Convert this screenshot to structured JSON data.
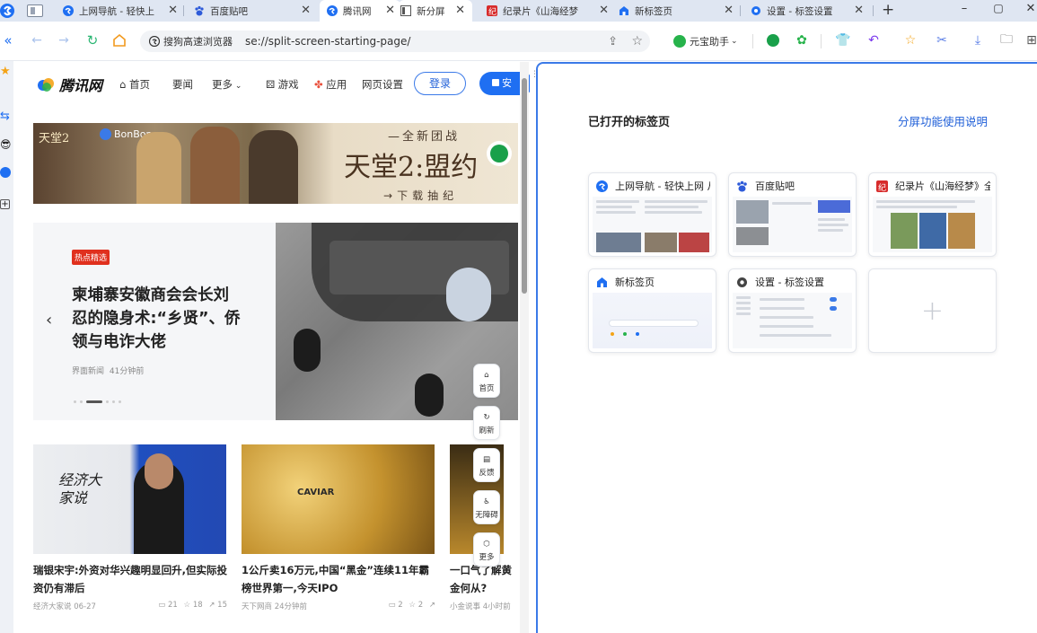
{
  "tabs": [
    {
      "label": "上网导航 - 轻快上",
      "icon": "sogou-logo-icon",
      "active": false
    },
    {
      "label": "百度贴吧",
      "icon": "baidu-paw-icon",
      "active": false
    },
    {
      "label": "腾讯网",
      "icon": "sogou-logo-icon",
      "active": true
    },
    {
      "label": "新分屏",
      "icon": "split-screen-icon",
      "active": false
    },
    {
      "label": "纪录片《山海经梦",
      "icon": "documentary-red-icon",
      "active": false
    },
    {
      "label": "新标签页",
      "icon": "home-icon",
      "active": false
    },
    {
      "label": "设置 - 标签设置",
      "icon": "gear-icon",
      "active": false
    }
  ],
  "toolbar": {
    "site_label": "搜狗高速浏览器",
    "url": "se://split-screen-starting-page/",
    "assistant_label": "元宝助手"
  },
  "qq_nav": {
    "logo_text": "腾讯网",
    "items": [
      "首页",
      "要闻",
      "更多",
      "游戏",
      "应用",
      "网页设置"
    ],
    "login_label": "登录",
    "install_label": "安"
  },
  "banner": {
    "game_title": "天堂2",
    "brand": "BonBon",
    "headline": "天堂2:盟约",
    "top_text": "全新团战",
    "bottom_text": "下载抽纪"
  },
  "hero": {
    "badge": "热点精选",
    "title": "柬埔寨安徽商会会长刘忍的隐身术:“乡贤”、侨领与电诈大佬",
    "source": "界面新闻",
    "time": "41分钟前"
  },
  "side_buttons": [
    "首页",
    "刷新",
    "反馈",
    "无障碍",
    "更多"
  ],
  "news": [
    {
      "title": "瑞银宋宇:外资对华兴趣明显回升,但实际投资仍有滞后",
      "source": "经济大家说",
      "time": "06-27",
      "comments": "21",
      "likes": "18",
      "shares": "15",
      "thumb_text": "经济大家说"
    },
    {
      "title": "1公斤卖16万元,中国“黑金”连续11年霸榜世界第一,今天IPO",
      "source": "天下网商",
      "time": "24分钟前",
      "comments": "2",
      "likes": "2",
      "shares": "",
      "thumb_text": "CAVIAR"
    },
    {
      "title": "一口气了解黄金何从?",
      "source": "小金说事",
      "time": "4小时前",
      "comments": "",
      "likes": "",
      "shares": "",
      "thumb_text": ""
    }
  ],
  "right": {
    "section_title": "已打开的标签页",
    "help_link": "分屏功能使用说明",
    "cards": [
      {
        "title": "上网导航 - 轻快上网 从",
        "icon": "sogou-logo-icon"
      },
      {
        "title": "百度贴吧",
        "icon": "baidu-paw-icon"
      },
      {
        "title": "纪录片《山海经梦》全",
        "icon": "documentary-red-icon"
      },
      {
        "title": "新标签页",
        "icon": "home-icon"
      },
      {
        "title": "设置 - 标签设置",
        "icon": "gear-icon"
      }
    ],
    "add_label": "+"
  },
  "colors": {
    "accent": "#3b7ae8",
    "tabbar": "#dfe6f2",
    "hot_red": "#e0301e"
  }
}
